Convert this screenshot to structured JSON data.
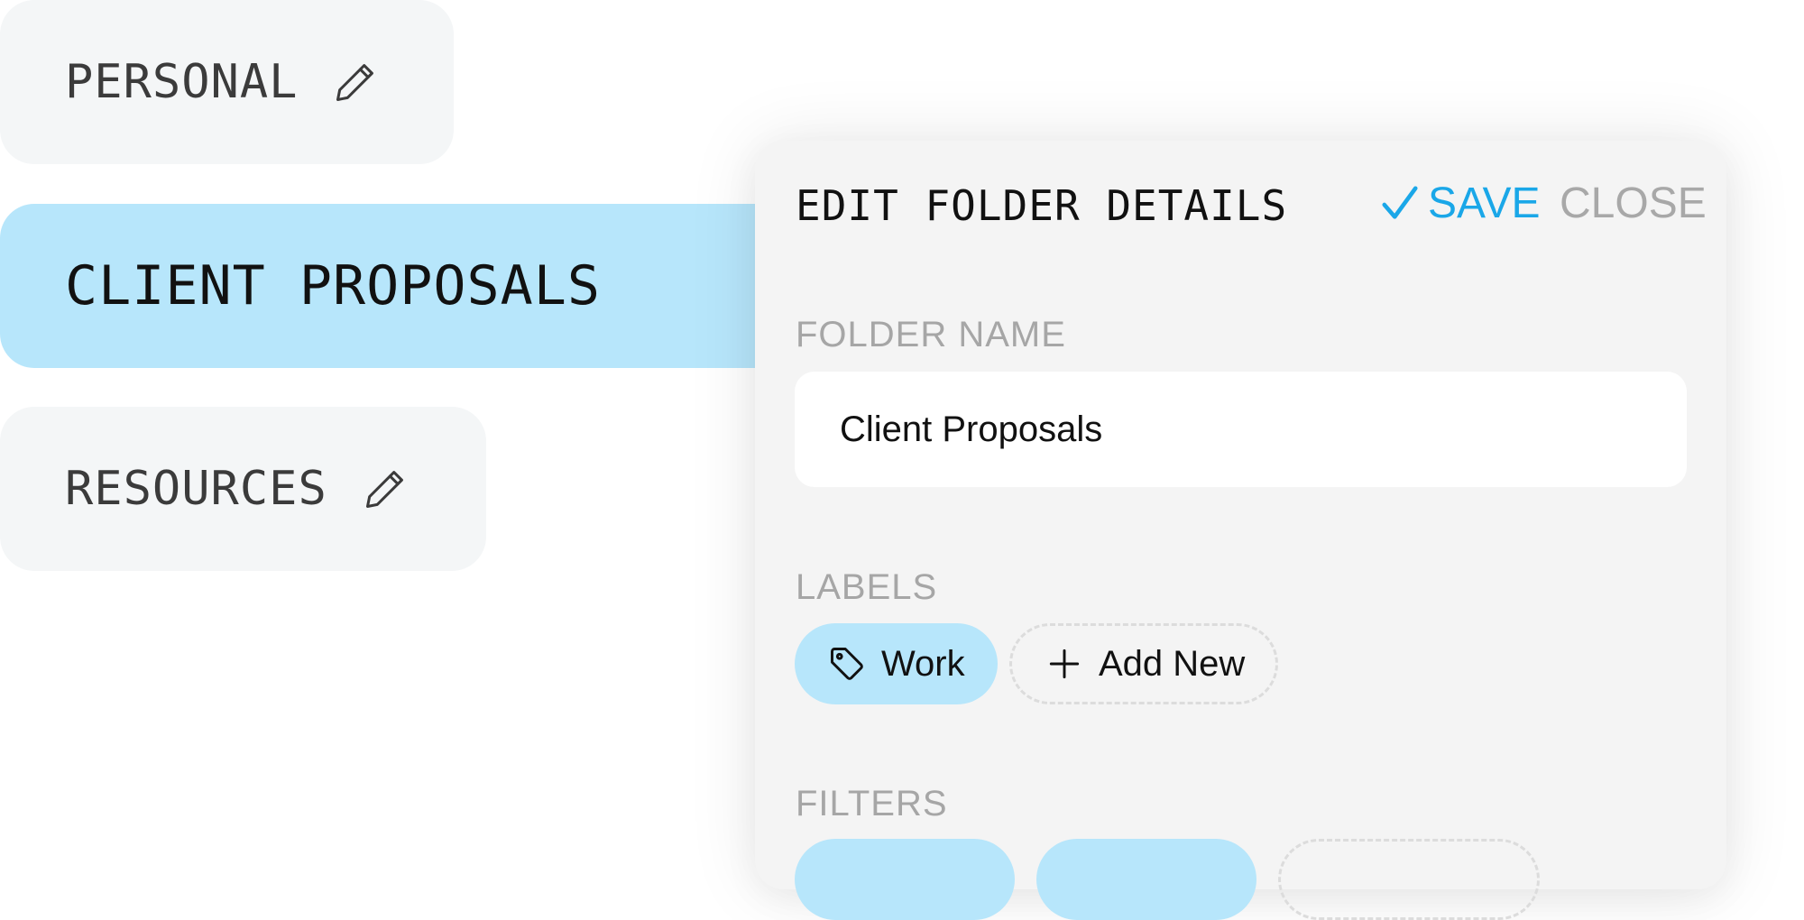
{
  "folders": {
    "personal": {
      "label": "PERSONAL",
      "icon": "pencil-icon"
    },
    "client": {
      "label": "CLIENT PROPOSALS"
    },
    "resources": {
      "label": "RESOURCES",
      "icon": "pencil-icon"
    }
  },
  "panel": {
    "title": "EDIT FOLDER DETAILS",
    "save_label": "SAVE",
    "save_icon": "check-icon",
    "close_label": "CLOSE",
    "folder_name_label": "FOLDER NAME",
    "folder_name_value": "Client Proposals",
    "labels_label": "LABELS",
    "labels": [
      {
        "text": "Work",
        "icon": "tag-icon"
      }
    ],
    "add_new_label": "Add New",
    "add_icon": "plus-icon",
    "filters_label": "FILTERS"
  },
  "colors": {
    "accent": "#1aa7e8",
    "selected_bg": "#b7e6fb",
    "panel_bg": "#f4f4f4",
    "muted": "#a6a6a6"
  }
}
